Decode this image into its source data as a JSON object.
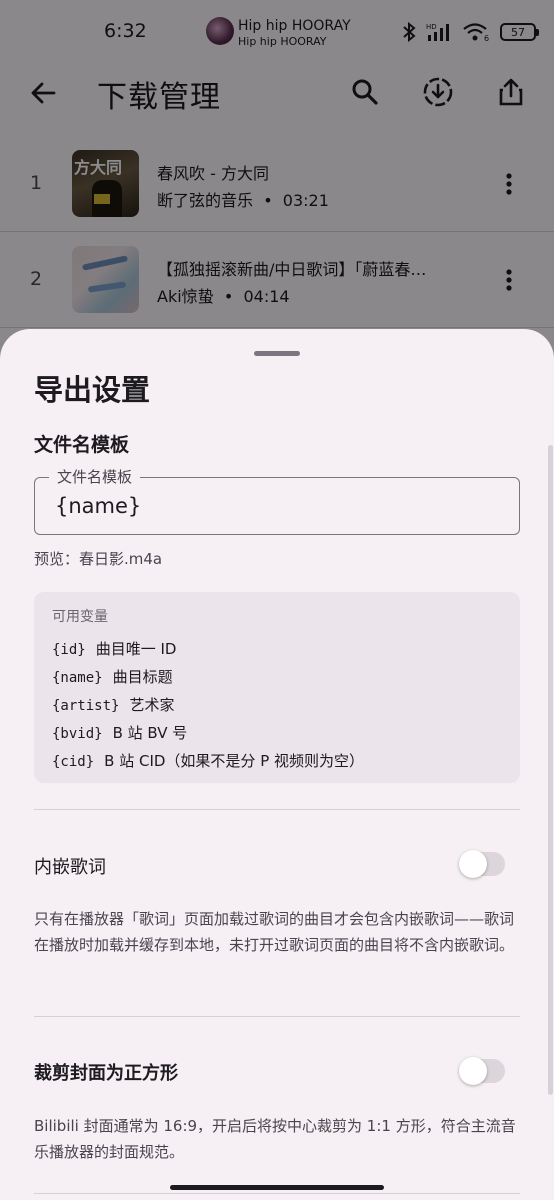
{
  "status_bar": {
    "time": "6:32",
    "media_title": "Hip hip HOORAY",
    "media_subtitle": "Hip hip HOORAY",
    "network_badge": "HD",
    "wifi_badge": "6",
    "battery": "57"
  },
  "app_bar": {
    "title": "下载管理",
    "icons": [
      "back-arrow-icon",
      "search-icon",
      "download-circle-icon",
      "share-icon"
    ]
  },
  "downloads": [
    {
      "index": "1",
      "title": "春风吹 - 方大同",
      "artist": "断了弦的音乐",
      "separator": "•",
      "duration": "03:21",
      "cover_text": "方大同"
    },
    {
      "index": "2",
      "title": "【孤独摇滚新曲/中日歌词】「蔚蓝春…",
      "artist": "Aki惊蛰",
      "separator": "•",
      "duration": "04:14"
    }
  ],
  "sheet": {
    "title": "导出设置",
    "filename_section": {
      "label": "文件名模板",
      "field_label": "文件名模板",
      "field_value": "{name}",
      "preview": "预览：春日影.m4a"
    },
    "variables": {
      "heading": "可用变量",
      "items": [
        {
          "code": "{id}",
          "desc": "曲目唯一 ID"
        },
        {
          "code": "{name}",
          "desc": "曲目标题"
        },
        {
          "code": "{artist}",
          "desc": "艺术家"
        },
        {
          "code": "{bvid}",
          "desc": "B 站 BV 号"
        },
        {
          "code": "{cid}",
          "desc": "B 站 CID（如果不是分 P 视频则为空）"
        }
      ]
    },
    "embed_lyrics": {
      "label": "内嵌歌词",
      "enabled": false,
      "description": "只有在播放器「歌词」页面加载过歌词的曲目才会包含内嵌歌词——歌词在播放时加载并缓存到本地，未打开过歌词页面的曲目将不含内嵌歌词。"
    },
    "crop_cover": {
      "label": "裁剪封面为正方形",
      "enabled": false,
      "description": "Bilibili 封面通常为 16:9，开启后将按中心裁剪为 1:1 方形，符合主流音乐播放器的封面规范。"
    }
  }
}
